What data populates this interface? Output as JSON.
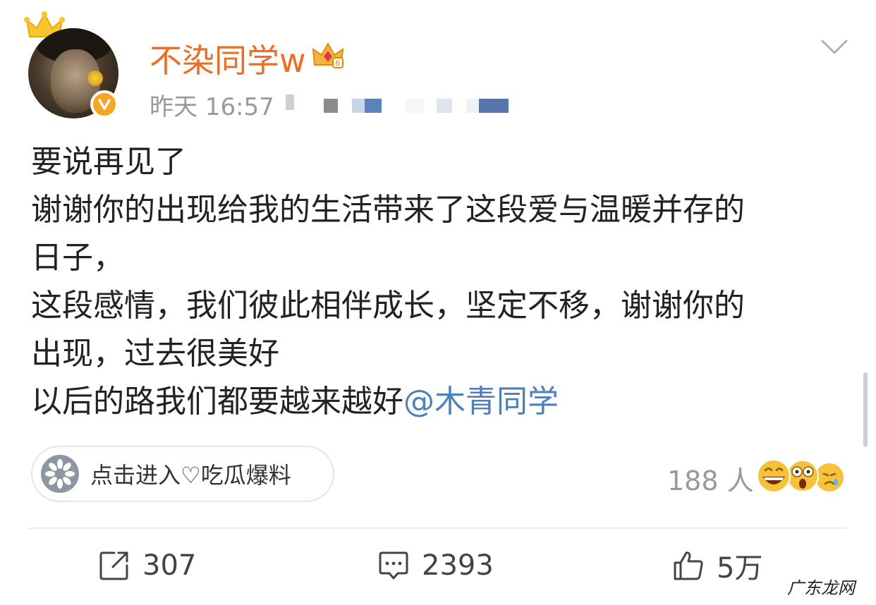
{
  "post": {
    "username": "不染同学w",
    "timestamp": "昨天 16:57",
    "lines": [
      "要说再见了",
      "谢谢你的出现给我的生活带来了这段爱与温暖并存的",
      "日子，",
      "这段感情，我们彼此相伴成长，坚定不移，谢谢你的",
      "出现，过去很美好"
    ],
    "last_line_prefix": "以后的路我们都要越来越好",
    "mention": "@木青同学"
  },
  "topic": {
    "label": "点击进入♡吃瓜爆料",
    "icon": "sunflower-topic-icon"
  },
  "reactions": {
    "count_text": "188 人",
    "emojis": [
      "laugh-emoji",
      "shocked-emoji",
      "sad-emoji"
    ]
  },
  "actions": {
    "repost": {
      "count": "307",
      "icon": "repost-icon"
    },
    "comment": {
      "count": "2393",
      "icon": "comment-icon"
    },
    "like": {
      "count": "5万",
      "icon": "thumbs-up-icon"
    }
  },
  "watermark": "广东龙网",
  "colors": {
    "username": "#ec6e23",
    "mention": "#4d7fb9",
    "verified": "#f6a623"
  }
}
